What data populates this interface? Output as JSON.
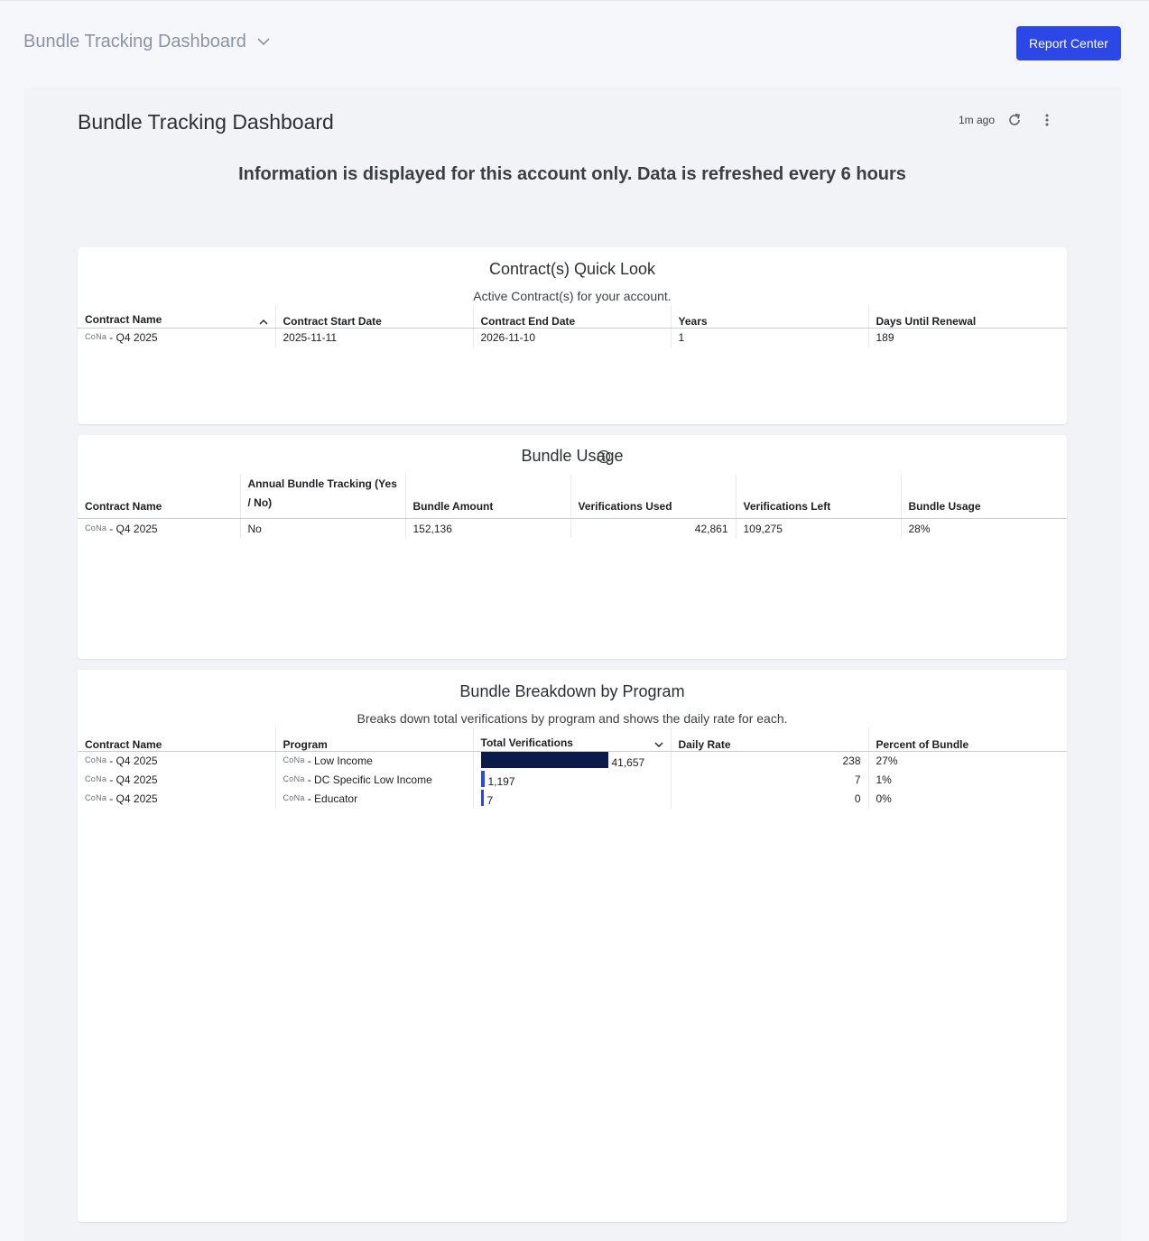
{
  "header": {
    "dashboard_selector": "Bundle Tracking Dashboard",
    "report_center_label": "Report Center"
  },
  "report": {
    "title": "Bundle Tracking Dashboard",
    "last_updated": "1m ago",
    "banner": "Information is displayed for this account only. Data is refreshed every 6 hours"
  },
  "colors": {
    "accent": "#2b48e6",
    "bar_dark": "#0c1a4b",
    "bar_light": "#2b48e6"
  },
  "contracts": {
    "title": "Contract(s) Quick Look",
    "subtitle": "Active Contract(s) for your account.",
    "columns": [
      "Contract Name",
      "Contract Start Date",
      "Contract End Date",
      "Years",
      "Days Until Renewal"
    ],
    "rows": [
      {
        "prefix": "CoNa",
        "name": "- Q4 2025",
        "start": "2025-11-11",
        "end": "2026-11-10",
        "years": "1",
        "days": "189"
      }
    ]
  },
  "usage": {
    "title": "Bundle Usage",
    "columns": [
      "Contract Name",
      "Annual Bundle Tracking (Yes / No)",
      "Bundle Amount",
      "Verifications Used",
      "Verifications Left",
      "Bundle Usage"
    ],
    "rows": [
      {
        "prefix": "CoNa",
        "name": "- Q4 2025",
        "annual": "No",
        "amount": "152,136",
        "used": "42,861",
        "left": "109,275",
        "usage": "28%"
      }
    ]
  },
  "breakdown": {
    "title": "Bundle Breakdown by Program",
    "subtitle": "Breaks down total verifications by program and shows the daily rate for each.",
    "columns": [
      "Contract Name",
      "Program",
      "Total Verifications",
      "Daily Rate",
      "Percent of Bundle"
    ],
    "rows": [
      {
        "prefix": "CoNa",
        "name": "- Q4 2025",
        "program_prefix": "CoNa",
        "program": "- Low Income",
        "total": "41,657",
        "total_value": 41657,
        "daily": "238",
        "percent": "27%"
      },
      {
        "prefix": "CoNa",
        "name": "- Q4 2025",
        "program_prefix": "CoNa",
        "program": "- DC Specific Low Income",
        "total": "1,197",
        "total_value": 1197,
        "daily": "7",
        "percent": "1%"
      },
      {
        "prefix": "CoNa",
        "name": "- Q4 2025",
        "program_prefix": "CoNa",
        "program": "- Educator",
        "total": "7",
        "total_value": 7,
        "daily": "0",
        "percent": "0%"
      }
    ]
  }
}
